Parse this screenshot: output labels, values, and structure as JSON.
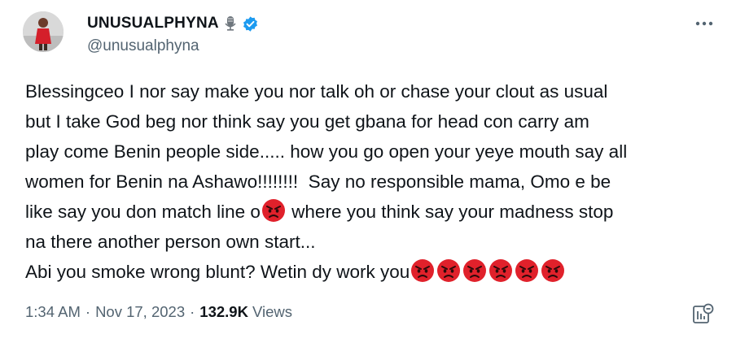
{
  "tweet": {
    "author": {
      "display_name": "UNUSUALPHYNA",
      "handle": "@unusualphyna"
    },
    "text": {
      "seg1": "Blessingceo I nor say make you nor talk oh or chase your clout as usual\nbut I take God beg nor think say you get gbana for head con carry am\nplay come Benin people side..... how you go open your yeye mouth say all\nwomen for Benin na Ashawo!!!!!!!!  Say no responsible mama, Omo e be\nlike say you don match line o",
      "seg2": " where you think say your madness stop\nna there another person own start...\nAbi you smoke wrong blunt? Wetin dy work you"
    },
    "emoji": {
      "inline_count": 1,
      "trailing_count": 6,
      "name": "angry-face"
    },
    "meta": {
      "time": "1:34 AM",
      "separator": "·",
      "date": "Nov 17, 2023",
      "views_count": "132.9K",
      "views_label": "Views"
    },
    "colors": {
      "text": "#0f1419",
      "secondary": "#536471",
      "verified": "#1d9bf0",
      "emoji_red": "#e0212b"
    }
  }
}
